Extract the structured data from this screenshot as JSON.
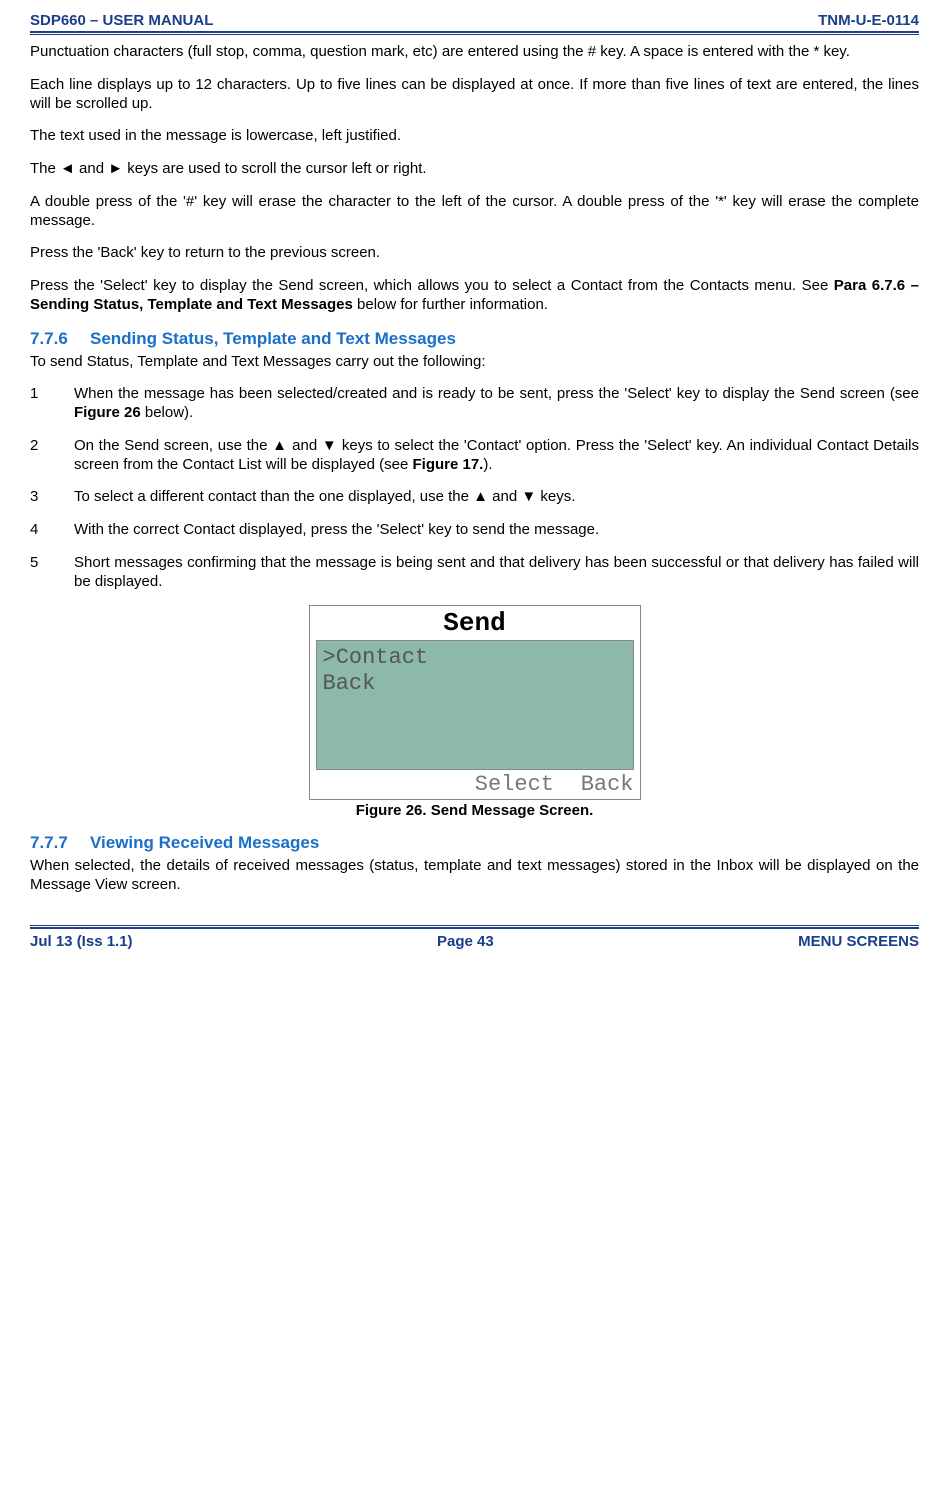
{
  "header": {
    "left": "SDP660 – USER MANUAL",
    "right": "TNM-U-E-0114"
  },
  "paras": {
    "p1": "Punctuation characters (full stop, comma, question mark, etc) are entered using the # key.  A space is entered with the * key.",
    "p2": "Each line displays up to 12 characters.  Up to five lines can be displayed at once.  If more than five lines of text are entered, the lines will be scrolled up.",
    "p3": "The text used in the message is lowercase, left justified.",
    "p4": "The ◄ and ► keys are used to scroll the cursor left or right.",
    "p5": "A double press of the '#' key will erase the character to the left of the cursor.  A double press of the '*' key will erase the complete message.",
    "p6": "Press the 'Back' key to return to the previous screen.",
    "p7a": "Press the 'Select' key to display the Send screen, which allows you to select a Contact from the Contacts menu.  See ",
    "p7b": "Para 6.7.6 – Sending Status, Template and Text Messages",
    "p7c": " below for further information."
  },
  "sec776": {
    "num": "7.7.6",
    "title": "Sending Status, Template and Text Messages",
    "intro": "To send Status, Template and Text Messages carry out the following:",
    "items": [
      {
        "n": "1",
        "t1": "When the message has been selected/created and is ready to be sent, press the 'Select' key to display the Send screen (see ",
        "b1": "Figure 26",
        "t2": " below)."
      },
      {
        "n": "2",
        "t1": "On the Send screen, use the ▲ and ▼ keys to select the 'Contact' option.  Press the 'Select' key.  An individual Contact Details screen from the Contact List will be displayed (see ",
        "b1": "Figure 17.",
        "t2": ")."
      },
      {
        "n": "3",
        "t1": "To select a different contact than the one displayed, use the ▲ and ▼ keys.",
        "b1": "",
        "t2": ""
      },
      {
        "n": "4",
        "t1": "With the correct Contact displayed, press the 'Select' key to send the message.",
        "b1": "",
        "t2": ""
      },
      {
        "n": "5",
        "t1": "Short messages confirming that the message is being sent and that delivery has been successful or that delivery has failed will be displayed.",
        "b1": "",
        "t2": ""
      }
    ]
  },
  "figure26": {
    "title": "Send",
    "line1": ">Contact",
    "line2": " Back",
    "soft_center": "Select",
    "soft_right": "Back",
    "caption": "Figure 26.  Send Message Screen."
  },
  "sec777": {
    "num": "7.7.7",
    "title": "Viewing Received Messages",
    "p1": "When selected, the details of received messages (status, template and text messages) stored in the Inbox will be displayed on the Message View screen."
  },
  "footer": {
    "left": "Jul 13 (Iss 1.1)",
    "center": "Page 43",
    "right": "MENU SCREENS"
  }
}
